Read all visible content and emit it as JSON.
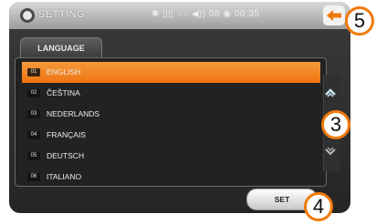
{
  "header": {
    "title": "SETTING",
    "status_icons": "✱ ▯▯",
    "status_dim": "●●",
    "status_text": "◀)) 08 ◉ 00:35"
  },
  "tab": {
    "label": "LANGUAGE"
  },
  "languages": [
    {
      "num": "01",
      "label": "ENGLISH"
    },
    {
      "num": "02",
      "label": "ČEŠTINA"
    },
    {
      "num": "03",
      "label": "NEDERLANDS"
    },
    {
      "num": "04",
      "label": "FRANÇAIS"
    },
    {
      "num": "05",
      "label": "DEUTSCH"
    },
    {
      "num": "06",
      "label": "ITALIANO"
    }
  ],
  "selected_index": 0,
  "set_label": "SET",
  "callouts": {
    "back": "5",
    "scroll": "3",
    "set": "4"
  },
  "colors": {
    "accent": "#f07a0c",
    "selected": "#f28a2a"
  }
}
